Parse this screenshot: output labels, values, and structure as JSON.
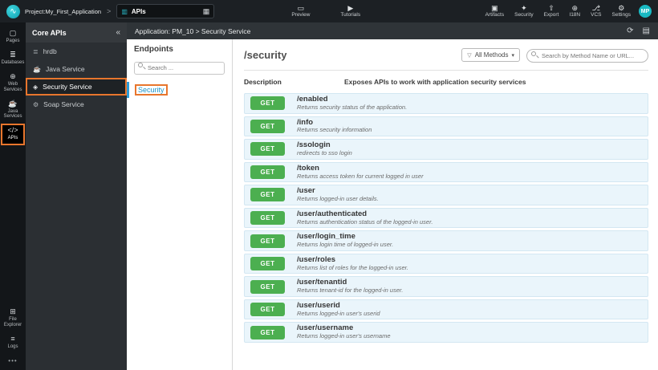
{
  "icons": {
    "logo": "∿",
    "chevron_right": ">",
    "selector_left": "▥",
    "grid": "▦",
    "preview": "▭",
    "tutorials": "▶",
    "artifacts": "▣",
    "security": "✦",
    "export": "⇧",
    "i18n": "⊕",
    "vcs": "⎇",
    "settings": "⚙",
    "pages": "▢",
    "databases": "≣",
    "web_services": "⊕",
    "java_services": "☕",
    "apis": "</>",
    "file_explorer": "⊞",
    "logs": "≡",
    "more": "•••",
    "collapse": "«",
    "hrdb": "≣",
    "java_service": "☕",
    "security_service": "◈",
    "soap_service": "⚙",
    "refresh": "⟳",
    "save": "▤",
    "funnel": "▽",
    "caret_down": "▾"
  },
  "topbar": {
    "project_label": "Project:My_First_Application",
    "selector_label": "APIs",
    "preview_label": "Preview",
    "tutorials_label": "Tutorials",
    "actions": [
      {
        "label": "Artifacts"
      },
      {
        "label": "Security"
      },
      {
        "label": "Export"
      },
      {
        "label": "I18N"
      },
      {
        "label": "VCS"
      },
      {
        "label": "Settings"
      }
    ],
    "avatar_initials": "MP"
  },
  "sidebar": {
    "items": [
      {
        "label": "Pages"
      },
      {
        "label": "Databases"
      },
      {
        "label": "Web Services"
      },
      {
        "label": "Java Services"
      },
      {
        "label": "APIs"
      }
    ],
    "bottom_items": [
      {
        "label": "File Explorer"
      },
      {
        "label": "Logs"
      }
    ],
    "more_label": "•••"
  },
  "apis_panel": {
    "title": "Core APIs",
    "items": [
      {
        "label": "hrdb"
      },
      {
        "label": "Java Service"
      },
      {
        "label": "Security Service"
      },
      {
        "label": "Soap Service"
      }
    ]
  },
  "breadcrumb": {
    "text": "Application: PM_10 > Security Service"
  },
  "endpoints_panel": {
    "title": "Endpoints",
    "search_placeholder": "Search ...",
    "items": [
      {
        "label": "Security"
      }
    ]
  },
  "main": {
    "title": "/security",
    "methods_filter_label": "All Methods",
    "search_placeholder": "Search by Method Name or URL...",
    "description_label": "Description",
    "description_text": "Exposes APIs to work with application security services",
    "endpoints": [
      {
        "method": "GET",
        "path": "/enabled",
        "description": "Returns security status of the application."
      },
      {
        "method": "GET",
        "path": "/info",
        "description": "Returns security information"
      },
      {
        "method": "GET",
        "path": "/ssologin",
        "description": "redirects to sso login"
      },
      {
        "method": "GET",
        "path": "/token",
        "description": "Returns access token for current logged in user"
      },
      {
        "method": "GET",
        "path": "/user",
        "description": "Returns logged-in user details."
      },
      {
        "method": "GET",
        "path": "/user/authenticated",
        "description": "Returns authentication status of the logged-in user."
      },
      {
        "method": "GET",
        "path": "/user/login_time",
        "description": "Returns login time of logged-in user."
      },
      {
        "method": "GET",
        "path": "/user/roles",
        "description": "Returns list of roles for the logged-in user."
      },
      {
        "method": "GET",
        "path": "/user/tenantid",
        "description": "Returns tenant-id for the logged-in user."
      },
      {
        "method": "GET",
        "path": "/user/userid",
        "description": "Returns logged-in user's userid"
      },
      {
        "method": "GET",
        "path": "/user/username",
        "description": "Returns logged-in user's username"
      }
    ]
  },
  "colors": {
    "accent_teal": "#19b9c3",
    "get_green": "#4caf50",
    "annotation_orange": "#e8762d",
    "row_background": "#eaf5fb"
  }
}
